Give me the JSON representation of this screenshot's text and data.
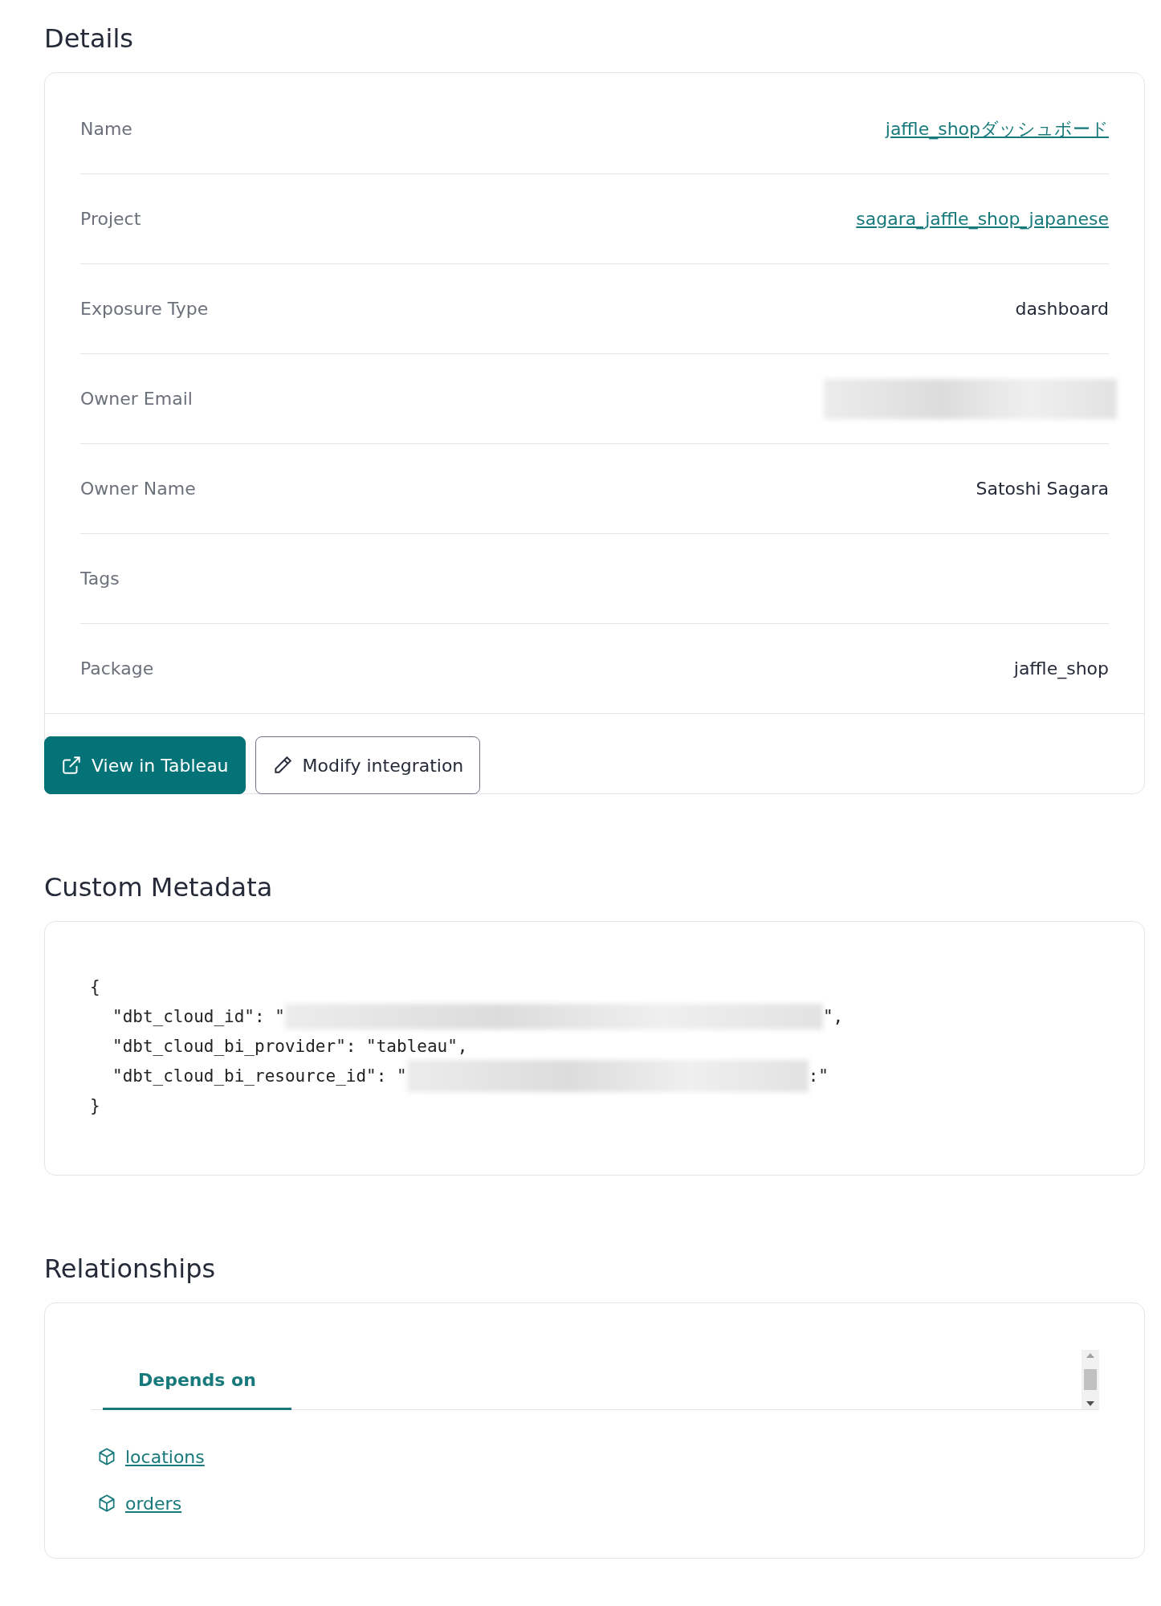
{
  "details": {
    "title": "Details",
    "rows": [
      {
        "label": "Name",
        "value": "jaffle_shopダッシュボード",
        "kind": "link"
      },
      {
        "label": "Project",
        "value": "sagara_jaffle_shop_japanese",
        "kind": "link"
      },
      {
        "label": "Exposure Type",
        "value": "dashboard",
        "kind": "text"
      },
      {
        "label": "Owner Email",
        "kind": "redacted"
      },
      {
        "label": "Owner Name",
        "value": "Satoshi Sagara",
        "kind": "text"
      },
      {
        "label": "Tags",
        "kind": "empty"
      },
      {
        "label": "Package",
        "value": "jaffle_shop",
        "kind": "text"
      }
    ],
    "buttons": [
      {
        "label": "View in Tableau",
        "kind": "primary"
      },
      {
        "label": "Modify integration",
        "kind": "secondary"
      }
    ]
  },
  "custom_metadata": {
    "title": "Custom Metadata",
    "lines": [
      {
        "text": "{",
        "indented": false
      },
      {
        "text": "\"dbt_cloud_id\": \"",
        "redacted": true,
        "tail": "\",",
        "indented": true
      },
      {
        "text": "\"dbt_cloud_bi_provider\": \"tableau\",",
        "indented": true
      },
      {
        "text": "\"dbt_cloud_bi_resource_id\": \"",
        "redacted": true,
        "tail": ":\"",
        "indented": true
      },
      {
        "text": "}",
        "indented": false
      }
    ]
  },
  "relationships": {
    "title": "Relationships",
    "tabs": [
      {
        "label": "Depends on",
        "selected": true
      }
    ],
    "items": [
      {
        "label": "locations"
      },
      {
        "label": "orders"
      }
    ]
  }
}
